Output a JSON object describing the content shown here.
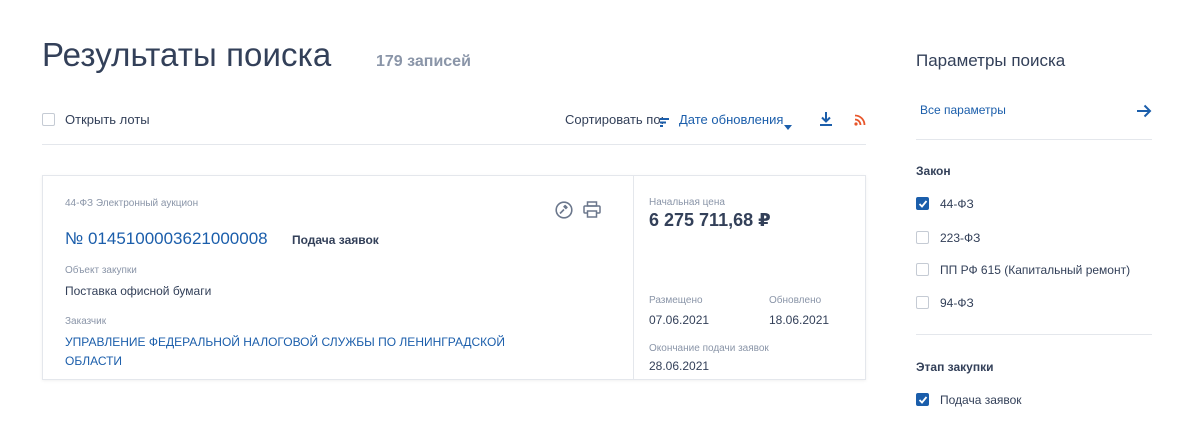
{
  "header": {
    "title": "Результаты поиска",
    "count": "179 записей"
  },
  "toolbar": {
    "open_lots_label": "Открыть лоты",
    "sort_label": "Сортировать по:",
    "sort_value": "Дате обновления",
    "icons": [
      "sort-icon",
      "chevron-down-icon",
      "download-icon",
      "rss-icon"
    ]
  },
  "result": {
    "type": "44-ФЗ Электронный аукцион",
    "number": "№ 0145100003621000008",
    "stage": "Подача заявок",
    "object_label": "Объект закупки",
    "object_value": "Поставка офисной бумаги",
    "customer_label": "Заказчик",
    "customer_value": "УПРАВЛЕНИЕ ФЕДЕРАЛЬНОЙ НАЛОГОВОЙ СЛУЖБЫ ПО ЛЕНИНГРАДСКОЙ ОБЛАСТИ",
    "price_label": "Начальная цена",
    "price_value": "6 275 711,68 ₽",
    "posted_label": "Размещено",
    "posted_value": "07.06.2021",
    "updated_label": "Обновлено",
    "updated_value": "18.06.2021",
    "deadline_label": "Окончание подачи заявок",
    "deadline_value": "28.06.2021",
    "icons": [
      "gavel-icon",
      "print-icon"
    ]
  },
  "sidebar": {
    "title": "Параметры поиска",
    "all_params": "Все параметры",
    "law_title": "Закон",
    "laws": [
      {
        "label": "44-ФЗ",
        "checked": true
      },
      {
        "label": "223-ФЗ",
        "checked": false
      },
      {
        "label": "ПП РФ 615 (Капитальный ремонт)",
        "checked": false
      },
      {
        "label": "94-ФЗ",
        "checked": false
      }
    ],
    "stage_title": "Этап закупки",
    "stages": [
      {
        "label": "Подача заявок",
        "checked": true
      }
    ]
  },
  "colors": {
    "accent": "#1b5eab",
    "text": "#334059",
    "muted": "#8a95a8",
    "rss": "#e8562b",
    "border": "#e4e7ec"
  }
}
